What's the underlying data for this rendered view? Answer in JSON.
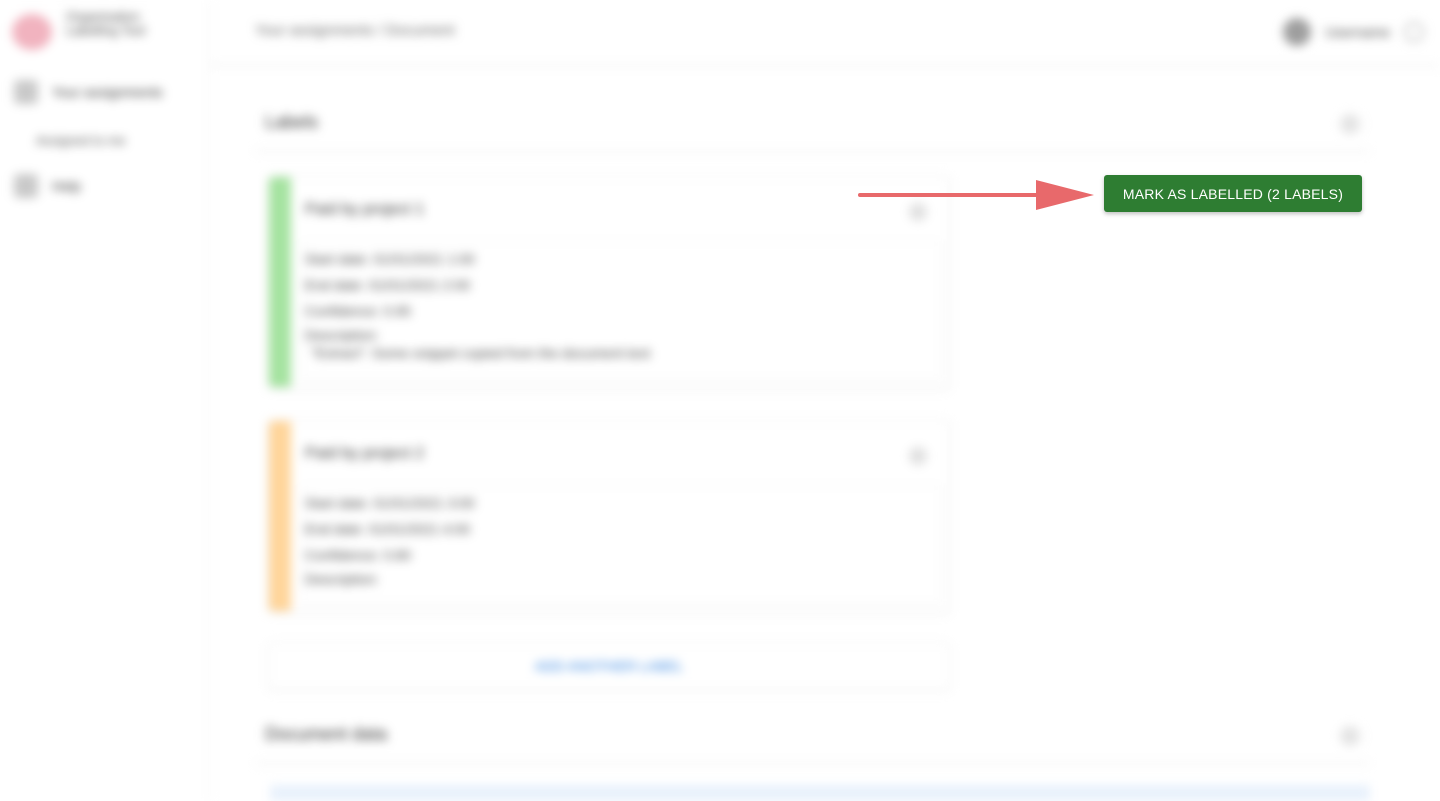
{
  "sidebar": {
    "logo_text": "Organisation Labelling Tool",
    "items": [
      {
        "label": "Your assignments",
        "icon": "assignment-icon"
      },
      {
        "label": "Assigned to me",
        "icon": ""
      },
      {
        "label": "Help",
        "icon": "help-icon"
      }
    ]
  },
  "header": {
    "breadcrumb": "Your assignments / Document",
    "user_name": "Username"
  },
  "labels_section": {
    "title": "Labels",
    "cards": [
      {
        "title": "Paid by project 1",
        "accent": "#a5e3a0",
        "fields": {
          "start": "Start date: 01/01/2021 1:00",
          "end": "End date: 01/01/2021 2:00",
          "confidence": "Confidence: 0.95",
          "description_label": "Description:",
          "description_value": "\"Extract\": Some snippet copied from the document text"
        }
      },
      {
        "title": "Paid by project 2",
        "accent": "#ffd59a",
        "fields": {
          "start": "Start date: 01/01/2021 3:00",
          "end": "End date: 01/01/2021 4:00",
          "confidence": "Confidence: 0.80",
          "description_label": "Description:"
        }
      }
    ],
    "add_label": "ADD ANOTHER LABEL"
  },
  "document_section": {
    "title": "Document data"
  },
  "actions": {
    "mark_labelled": "MARK AS LABELLED (2 LABELS)"
  },
  "colors": {
    "primary_green": "#2e7d32",
    "arrow_red": "#e8696b",
    "link_blue": "#2b7fe0"
  }
}
